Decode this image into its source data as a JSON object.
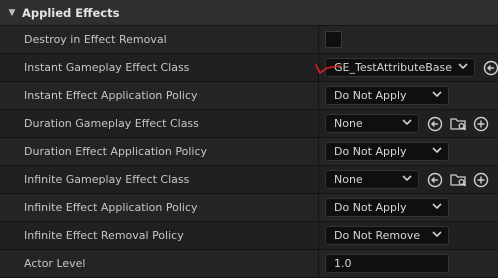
{
  "section": {
    "title": "Applied Effects"
  },
  "rows": [
    {
      "label": "Destroy in Effect Removal"
    },
    {
      "label": "Instant Gameplay Effect Class",
      "value": "GE_TestAttributeBased"
    },
    {
      "label": "Instant Effect Application Policy",
      "value": "Do Not Apply"
    },
    {
      "label": "Duration Gameplay Effect Class",
      "value": "None"
    },
    {
      "label": "Duration Effect Application Policy",
      "value": "Do Not Apply"
    },
    {
      "label": "Infinite Gameplay Effect Class",
      "value": "None"
    },
    {
      "label": "Infinite Effect Application Policy",
      "value": "Do Not Apply"
    },
    {
      "label": "Infinite Effect Removal Policy",
      "value": "Do Not Remove"
    },
    {
      "label": "Actor Level",
      "value": "1.0"
    }
  ],
  "icons": {
    "collapse": "triangle-down-icon",
    "use_selected": "arrow-left-circle-icon",
    "browse": "folder-search-icon",
    "add": "plus-circle-icon"
  },
  "colors": {
    "annotation": "#e02020"
  }
}
